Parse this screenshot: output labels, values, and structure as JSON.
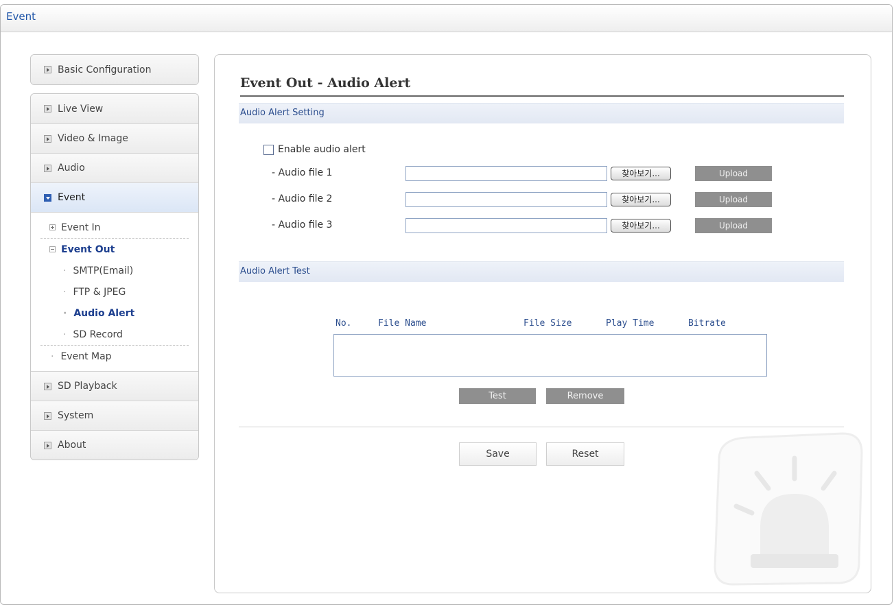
{
  "window": {
    "title": "Event"
  },
  "sidebar": {
    "basic": "Basic Configuration",
    "items": [
      "Live View",
      "Video & Image",
      "Audio",
      "Event"
    ],
    "event_tree": {
      "event_in": "Event In",
      "event_out": "Event Out",
      "children": [
        "SMTP(Email)",
        "FTP & JPEG",
        "Audio Alert",
        "SD Record"
      ],
      "event_map": "Event Map"
    },
    "items2": [
      "SD Playback",
      "System",
      "About"
    ]
  },
  "main": {
    "title": "Event Out - Audio Alert",
    "setting_header": "Audio Alert Setting",
    "enable_label": "Enable audio alert",
    "enable_checked": false,
    "files": [
      {
        "label": "- Audio file 1",
        "value": "",
        "browse": "찾아보기...",
        "upload": "Upload"
      },
      {
        "label": "- Audio file 2",
        "value": "",
        "browse": "찾아보기...",
        "upload": "Upload"
      },
      {
        "label": "- Audio file 3",
        "value": "",
        "browse": "찾아보기...",
        "upload": "Upload"
      }
    ],
    "test_header": "Audio Alert Test",
    "table_columns": [
      "No.",
      "File Name",
      "File Size",
      "Play Time",
      "Bitrate"
    ],
    "test_button": "Test",
    "remove_button": "Remove",
    "save_button": "Save",
    "reset_button": "Reset",
    "decoration_icon": "alarm-light-icon"
  }
}
